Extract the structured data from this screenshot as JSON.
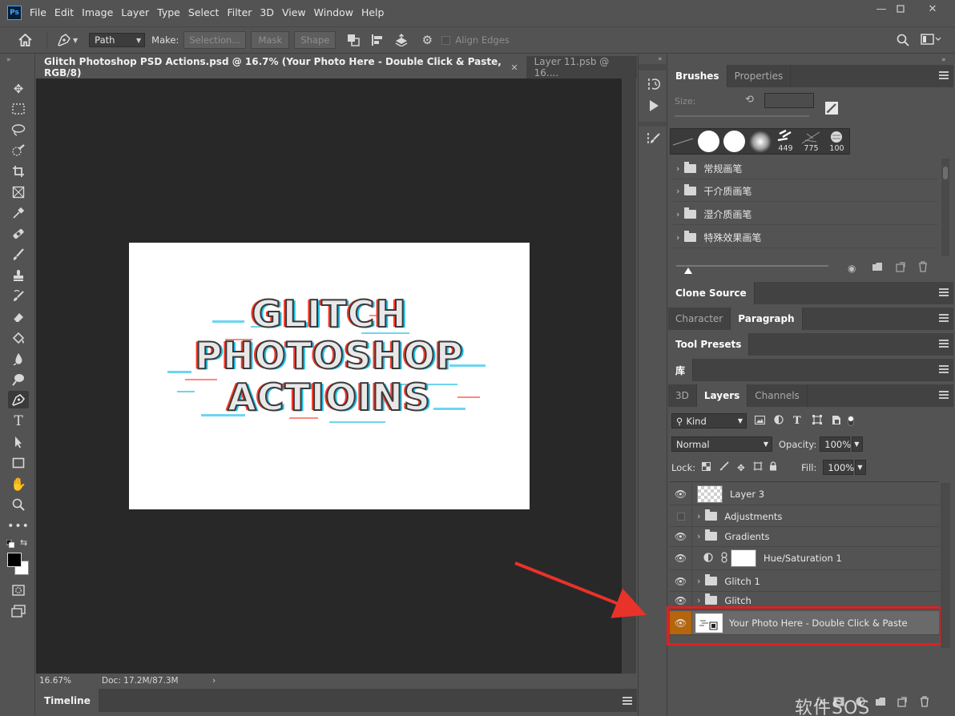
{
  "app": {
    "logo": "Ps",
    "menu": [
      "File",
      "Edit",
      "Image",
      "Layer",
      "Type",
      "Select",
      "Filter",
      "3D",
      "View",
      "Window",
      "Help"
    ]
  },
  "options": {
    "mode": "Path",
    "make_label": "Make:",
    "selection_btn": "Selection...",
    "mask_btn": "Mask",
    "shape_btn": "Shape",
    "align_edges": "Align Edges"
  },
  "document": {
    "tabs": [
      {
        "label": "Glitch Photoshop PSD Actions.psd @ 16.7% (Your Photo Here - Double Click & Paste, RGB/8)",
        "active": true
      },
      {
        "label": "Layer 11.psb @ 16....",
        "active": false
      }
    ],
    "artwork_lines": [
      "GLITCH",
      "PHOTOSHOP",
      "ACTIOINS"
    ],
    "zoom": "16.67%",
    "doc_info": "Doc: 17.2M/87.3M",
    "timeline_tab": "Timeline"
  },
  "brushes_panel": {
    "tabs": [
      "Brushes",
      "Properties"
    ],
    "size_label": "Size:",
    "presets": [
      "449",
      "775",
      "100"
    ],
    "folders": [
      "常规画笔",
      "干介质画笔",
      "湿介质画笔",
      "特殊效果画笔"
    ]
  },
  "panels": {
    "clone_source": "Clone Source",
    "character": "Character",
    "paragraph": "Paragraph",
    "tool_presets": "Tool Presets",
    "library": "库"
  },
  "layers_panel": {
    "tabs": [
      "3D",
      "Layers",
      "Channels"
    ],
    "filter_kind": "Kind",
    "blend_mode": "Normal",
    "opacity_label": "Opacity:",
    "opacity_value": "100%",
    "lock_label": "Lock:",
    "fill_label": "Fill:",
    "fill_value": "100%",
    "layers": [
      {
        "name": "Layer 3",
        "type": "layer",
        "visible": true
      },
      {
        "name": "Adjustments",
        "type": "group",
        "visible": false
      },
      {
        "name": "Gradients",
        "type": "group",
        "visible": true
      },
      {
        "name": "Hue/Saturation 1",
        "type": "adjustment",
        "visible": true
      },
      {
        "name": "Glitch 1",
        "type": "group",
        "visible": true
      },
      {
        "name": "Glitch",
        "type": "group",
        "visible": true
      },
      {
        "name": "Your Photo Here - Double Click & Paste",
        "type": "smart",
        "visible": true,
        "selected": true
      }
    ]
  },
  "watermark": "软件SOS",
  "colors": {
    "highlight_box": "#e02020",
    "arrow": "#e8322a",
    "selected_eye_bg": "#b5650d"
  }
}
